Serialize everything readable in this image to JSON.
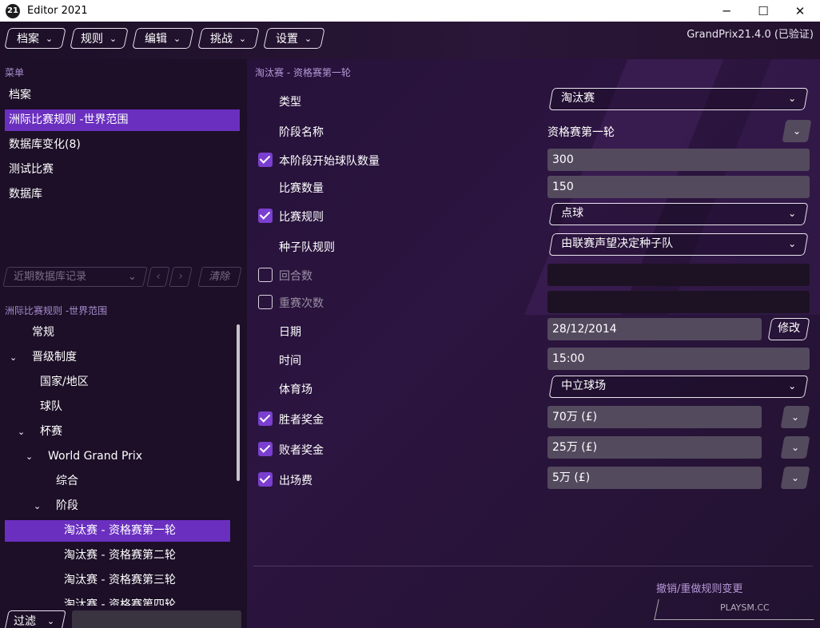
{
  "window": {
    "logo": "21",
    "title": "Editor 2021",
    "minimize": "─",
    "maximize": "☐",
    "close": "✕"
  },
  "toolbar": {
    "buttons": [
      "档案",
      "规则",
      "编辑",
      "挑战",
      "设置"
    ],
    "version": "GrandPrix21.4.0 (已验证)"
  },
  "left": {
    "menu_title": "菜单",
    "menu": [
      "档案",
      "洲际比赛规则 -世界范围",
      "数据库变化(8)",
      "测试比赛",
      "数据库"
    ],
    "recent_placeholder": "近期数据库记录",
    "clear_label": "清除",
    "tree_title": "洲际比赛规则 -世界范围",
    "tree": [
      {
        "label": "常规",
        "arrow": ""
      },
      {
        "label": "晋级制度",
        "arrow": "⌄"
      },
      {
        "label": "国家/地区",
        "arrow": ""
      },
      {
        "label": "球队",
        "arrow": ""
      },
      {
        "label": "杯赛",
        "arrow": "⌄"
      },
      {
        "label": "World Grand Prix",
        "arrow": "⌄"
      },
      {
        "label": "综合",
        "arrow": ""
      },
      {
        "label": "阶段",
        "arrow": "⌄"
      },
      {
        "label": "淘汰赛 - 资格赛第一轮",
        "arrow": ""
      },
      {
        "label": "淘汰赛 - 资格赛第二轮",
        "arrow": ""
      },
      {
        "label": "淘汰赛 - 资格赛第三轮",
        "arrow": ""
      },
      {
        "label": "淘汰赛 - 资格赛第四轮",
        "arrow": ""
      }
    ],
    "filter_label": "过滤"
  },
  "right": {
    "title": "淘汰赛 - 资格赛第一轮",
    "fields": {
      "type_label": "类型",
      "type_value": "淘汰赛",
      "stage_name_label": "阶段名称",
      "stage_name_value": "资格赛第一轮",
      "teams_label": "本阶段开始球队数量",
      "teams_value": "300",
      "matches_label": "比赛数量",
      "matches_value": "150",
      "rules_label": "比赛规则",
      "rules_value": "点球",
      "seed_label": "种子队规则",
      "seed_value": "由联赛声望决定种子队",
      "rounds_label": "回合数",
      "replays_label": "重赛次数",
      "date_label": "日期",
      "date_value": "28/12/2014",
      "modify_label": "修改",
      "time_label": "时间",
      "time_value": "15:00",
      "stadium_label": "体育场",
      "stadium_value": "中立球场",
      "winner_label": "胜者奖金",
      "winner_value": "70万 (£)",
      "loser_label": "败者奖金",
      "loser_value": "25万 (£)",
      "appearance_label": "出场费",
      "appearance_value": "5万 (£)"
    },
    "undo_redo": "撤销/重做规则变更",
    "watermark": "PLAYSM.CC"
  },
  "colors": {
    "accent": "#6a2fbf",
    "checkbox": "#7a3fd0",
    "bg": "#1c0f27"
  }
}
